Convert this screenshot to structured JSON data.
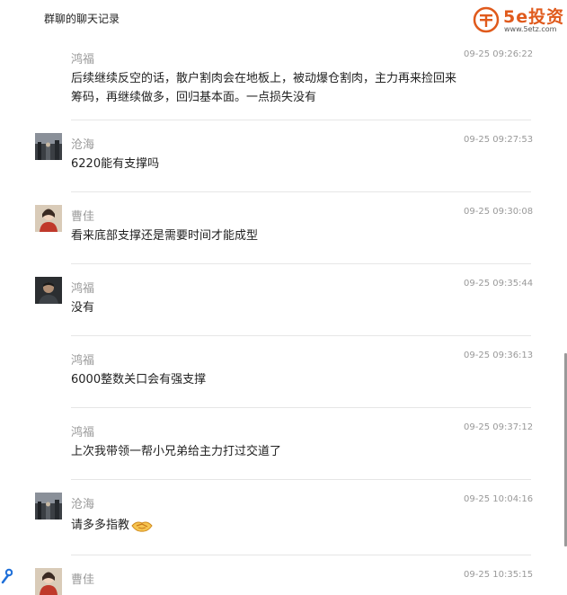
{
  "header": {
    "title": "群聊的聊天记录",
    "logo_brand": "5e投资",
    "logo_url": "www.5etz.com"
  },
  "messages": [
    {
      "sender": "鸿福",
      "time": "09-25 09:26:22",
      "text": "后续继续反空的话，散户割肉会在地板上，被动爆仓割肉，主力再来捡回来筹码，再继续做多，回归基本面。一点损失没有",
      "avatar": "none"
    },
    {
      "sender": "沧海",
      "time": "09-25 09:27:53",
      "text": "6220能有支撑吗",
      "avatar": "street-photo-avatar"
    },
    {
      "sender": "曹佳",
      "time": "09-25 09:30:08",
      "text": "看来底部支撑还是需要时间才能成型",
      "avatar": "woman-red-avatar"
    },
    {
      "sender": "鸿福",
      "time": "09-25 09:35:44",
      "text": "没有",
      "avatar": "man-dark-avatar"
    },
    {
      "sender": "鸿福",
      "time": "09-25 09:36:13",
      "text": "6000整数关口会有强支撑",
      "avatar": "none"
    },
    {
      "sender": "鸿福",
      "time": "09-25 09:37:12",
      "text": "上次我带领一帮小兄弟给主力打过交道了",
      "avatar": "none"
    },
    {
      "sender": "沧海",
      "time": "09-25 10:04:16",
      "text": "请多多指教",
      "avatar": "street-photo-avatar"
    },
    {
      "sender": "曹佳",
      "time": "09-25 10:35:15",
      "text": "",
      "avatar": "woman-red-avatar"
    }
  ],
  "colors": {
    "brand": "#e05a1c",
    "meta_text": "#999999",
    "body_text": "#222222",
    "divider": "#e6e6e6"
  }
}
